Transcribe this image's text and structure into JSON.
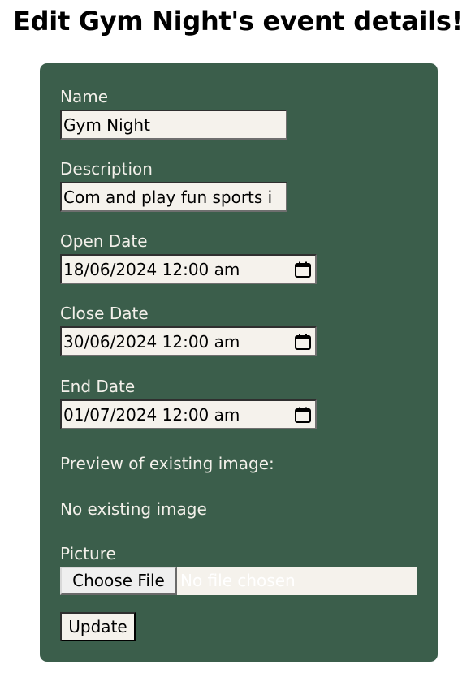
{
  "page": {
    "title": "Edit Gym Night's event details!"
  },
  "form": {
    "name": {
      "label": "Name",
      "value": "Gym Night"
    },
    "description": {
      "label": "Description",
      "value": "Com and play fun sports i"
    },
    "open_date": {
      "label": "Open Date",
      "value": "18/06/2024 12:00 am"
    },
    "close_date": {
      "label": "Close Date",
      "value": "30/06/2024 12:00 am"
    },
    "end_date": {
      "label": "End Date",
      "value": "01/07/2024 12:00 am"
    },
    "preview_label": "Preview of existing image:",
    "preview_status": "No existing image",
    "picture": {
      "label": "Picture",
      "button_label": "Choose File",
      "status": "No file chosen"
    },
    "submit_label": "Update"
  },
  "colors": {
    "card_background": "#3b5e4b",
    "label_text": "#f3f0ea",
    "input_background": "#f5f2ec"
  },
  "icons": {
    "date_picker": "calendar-icon"
  }
}
